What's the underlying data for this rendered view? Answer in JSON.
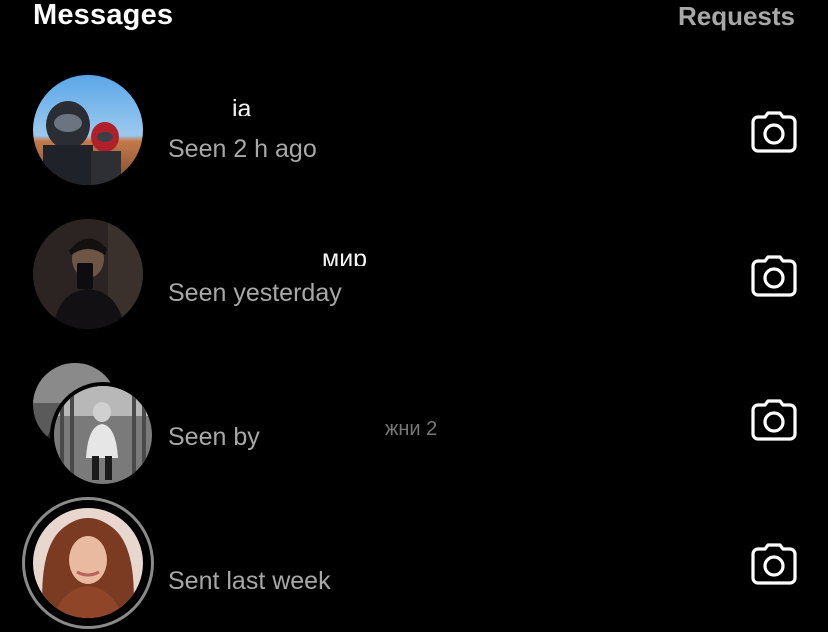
{
  "header": {
    "title": "Messages",
    "requests_label": "Requests"
  },
  "threads": [
    {
      "name": "ja",
      "status": "Seen 2 h ago",
      "avatar": "avatar-photo-motorcyclists",
      "camera_icon": "camera-icon"
    },
    {
      "name": "мир",
      "status": "Seen yesterday",
      "avatar": "avatar-photo-mirror-selfie",
      "camera_icon": "camera-icon"
    },
    {
      "name": "",
      "status": "Seen by",
      "status_tail": "жни 2",
      "avatar": "group-avatar-photos",
      "camera_icon": "camera-icon"
    },
    {
      "name": "",
      "status": "Sent last week",
      "avatar": "avatar-photo-woman-curly-hair",
      "camera_icon": "camera-icon"
    }
  ],
  "colors": {
    "background": "#000000",
    "primary_text": "#ffffff",
    "secondary_text": "#a8a8a8"
  }
}
